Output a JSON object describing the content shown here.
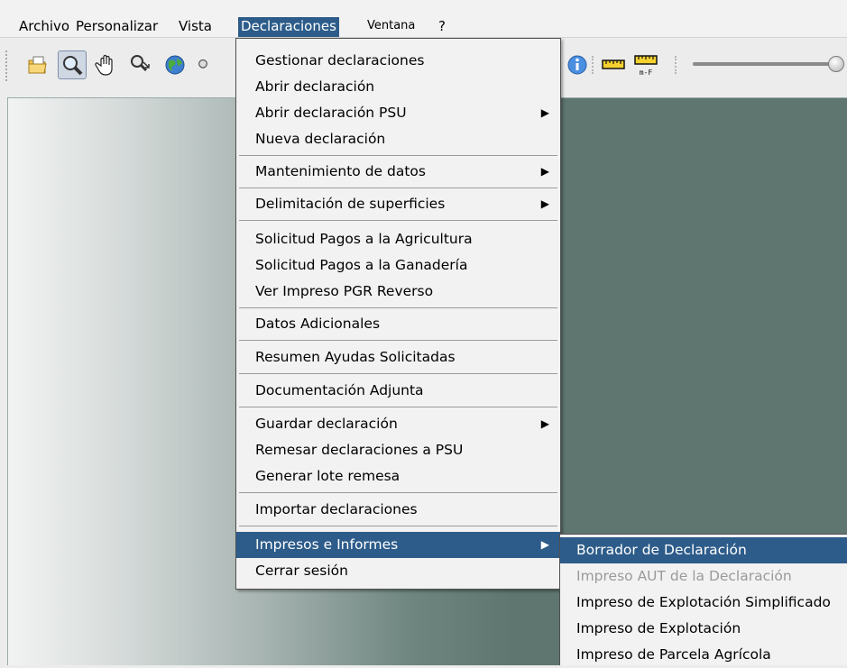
{
  "menubar": {
    "archivo": "Archivo",
    "personalizar": "Personalizar",
    "vista": "Vista",
    "declaraciones": "Declaraciones",
    "ventana": "Ventana",
    "help": "?"
  },
  "toolbar": {
    "icons": [
      "open-folder-icon",
      "zoom-icon",
      "pan-hand-icon",
      "zoom-area-icon",
      "globe-icon",
      "info-icon",
      "ruler-icon",
      "ruler-mf-icon"
    ],
    "ruler_mf_label": "m-F"
  },
  "declaraciones_menu": {
    "items": [
      {
        "label": "Gestionar declaraciones",
        "has_submenu": false
      },
      {
        "label": "Abrir declaración",
        "has_submenu": false
      },
      {
        "label": "Abrir declaración PSU",
        "has_submenu": true
      },
      {
        "label": "Nueva declaración",
        "has_submenu": false
      },
      {
        "label": "Mantenimiento de datos",
        "has_submenu": true
      },
      {
        "label": "Delimitación de superficies",
        "has_submenu": true
      },
      {
        "label": "Solicitud Pagos a la Agricultura",
        "has_submenu": false
      },
      {
        "label": "Solicitud Pagos a la Ganadería",
        "has_submenu": false
      },
      {
        "label": "Ver Impreso PGR Reverso",
        "has_submenu": false
      },
      {
        "label": "Datos Adicionales",
        "has_submenu": false
      },
      {
        "label": "Resumen Ayudas Solicitadas",
        "has_submenu": false
      },
      {
        "label": "Documentación Adjunta",
        "has_submenu": false
      },
      {
        "label": "Guardar declaración",
        "has_submenu": true
      },
      {
        "label": "Remesar declaraciones a PSU",
        "has_submenu": false
      },
      {
        "label": "Generar lote remesa",
        "has_submenu": false
      },
      {
        "label": "Importar declaraciones",
        "has_submenu": false
      },
      {
        "label": "Impresos e Informes",
        "has_submenu": true,
        "selected": true
      },
      {
        "label": "Cerrar sesión",
        "has_submenu": false
      }
    ]
  },
  "impresos_submenu": {
    "items": [
      {
        "label": "Borrador de Declaración",
        "selected": true
      },
      {
        "label": "Impreso AUT de la Declaración",
        "disabled": true
      },
      {
        "label": "Impreso de Explotación Simplificado"
      },
      {
        "label": "Impreso de Explotación"
      },
      {
        "label": "Impreso de Parcela Agrícola"
      }
    ]
  },
  "colors": {
    "highlight": "#2d5c8a",
    "menu_bg": "#f2f2f2",
    "workspace": "#5f7670",
    "disabled_text": "#9a9a9a"
  }
}
